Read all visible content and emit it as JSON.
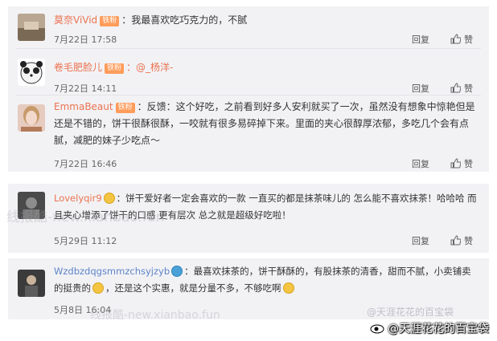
{
  "comments": [
    {
      "username": "莫奈ViVid",
      "badge": "铁粉",
      "text": "：我最喜欢吃巧克力的，不腻",
      "time": "7月22日 17:58",
      "reply_label": "回复",
      "like_label": "赞"
    },
    {
      "username": "卷毛肥脸儿",
      "badge": "铁粉",
      "mention": "：@_杨洋-",
      "time": "7月22日 14:11",
      "reply_label": "回复",
      "like_label": "赞"
    },
    {
      "username": "EmmaBeaut",
      "badge": "铁粉",
      "text": "：反馈：这个好吃，之前看到好多人安利就买了一次，虽然没有想象中惊艳但是还是不错的，饼干很酥很酥，一咬就有很多易碎掉下来。里面的夹心很醇厚浓郁，多吃几个会有点腻，减肥的妹子少吃点～",
      "time": "7月22日 16:46",
      "reply_label": "回复",
      "like_label": "赞"
    },
    {
      "username": "Lovelyqir9",
      "text": "：饼干爱好者一定会喜欢的一款 一直买的都是抹茶味儿的 怎么能不喜欢抹茶！哈哈哈 而且夹心增添了饼干的口感 更有层次 总之就是超级好吃啦！",
      "time": "5月29日 11:12",
      "reply_label": "回复",
      "like_label": "赞"
    },
    {
      "username": "Wzdbzdqgsmmzchsyjzyb",
      "text_a": "：最喜欢抹茶的，饼干酥酥的，有股抹茶的清香，甜而不腻，小卖铺卖的挺贵的",
      "text_b": "，还是这个实惠，就是分量不多，不够吃啊",
      "time": "5月8日 16:04",
      "reply_label": "回复",
      "like_label": "赞"
    }
  ],
  "watermarks": {
    "left": "线报酷-new.xianbao.fun",
    "faint": "@天涯花花的百宝袋",
    "footer": "@天涯花花的百宝袋"
  }
}
